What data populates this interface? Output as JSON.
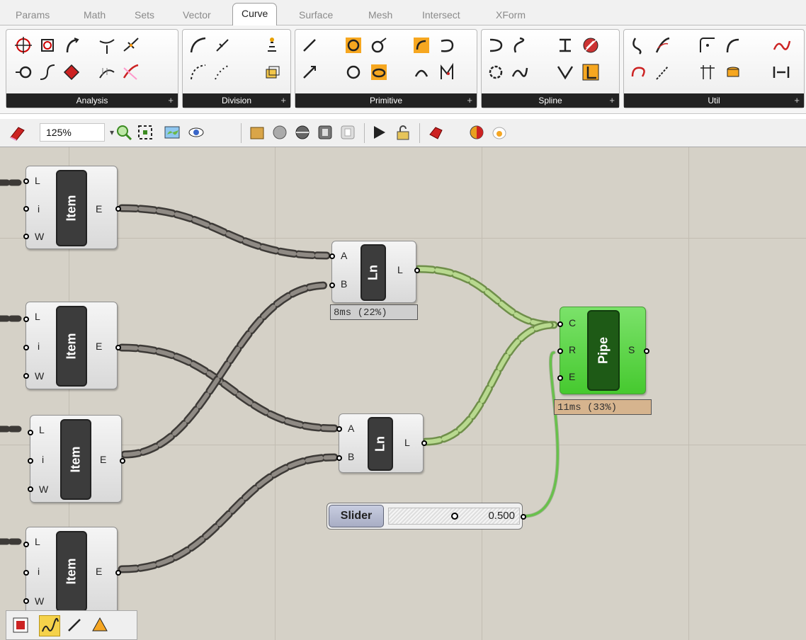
{
  "tabs": [
    {
      "label": "Params",
      "active": false
    },
    {
      "label": "Math",
      "active": false
    },
    {
      "label": "Sets",
      "active": false
    },
    {
      "label": "Vector",
      "active": false
    },
    {
      "label": "Curve",
      "active": true
    },
    {
      "label": "Surface",
      "active": false
    },
    {
      "label": "Mesh",
      "active": false
    },
    {
      "label": "Intersect",
      "active": false
    },
    {
      "label": "XForm",
      "active": false
    }
  ],
  "ribbon": {
    "groups": [
      {
        "label": "Analysis",
        "expand": "+"
      },
      {
        "label": "Division",
        "expand": "+"
      },
      {
        "label": "Primitive",
        "expand": "+"
      },
      {
        "label": "Spline",
        "expand": "+"
      },
      {
        "label": "Util",
        "expand": "+"
      }
    ]
  },
  "toolbar": {
    "zoom": "125%",
    "icons": [
      "eraser-icon",
      "zoom-icon",
      "zoom-extents-icon",
      "map-icon",
      "eye-icon",
      "box-preview-icon",
      "sphere-preview-icon",
      "mesh-preview-icon",
      "wire-icon",
      "disabled-icon",
      "play-icon",
      "lock-icon",
      "gem-icon",
      "contrast-icon",
      "egg-icon"
    ]
  },
  "canvas": {
    "item_nodes": [
      {
        "title": "Item",
        "inputs": [
          "L",
          "i",
          "W"
        ],
        "output": "E"
      },
      {
        "title": "Item",
        "inputs": [
          "L",
          "i",
          "W"
        ],
        "output": "E"
      },
      {
        "title": "Item",
        "inputs": [
          "L",
          "i",
          "W"
        ],
        "output": "E"
      },
      {
        "title": "Item",
        "inputs": [
          "L",
          "i",
          "W"
        ],
        "output": "E"
      }
    ],
    "line_nodes": [
      {
        "title": "Ln",
        "inputs": [
          "A",
          "B"
        ],
        "output": "L",
        "timing": "8ms (22%)"
      },
      {
        "title": "Ln",
        "inputs": [
          "A",
          "B"
        ],
        "output": "L"
      }
    ],
    "pipe_node": {
      "title": "Pipe",
      "inputs": [
        "C",
        "R",
        "E"
      ],
      "output": "S",
      "timing": "11ms (33%)"
    },
    "slider": {
      "label": "Slider",
      "value": "0.500"
    },
    "colors": {
      "canvas": "#d5d1c7",
      "wire": "#5a5550",
      "wire_selected": "#9cc36e",
      "pipe": "#55cc3a"
    }
  },
  "bottom_toolbar": {
    "icons": [
      "frame-icon",
      "sketch-icon",
      "line-icon",
      "cone-icon"
    ]
  }
}
